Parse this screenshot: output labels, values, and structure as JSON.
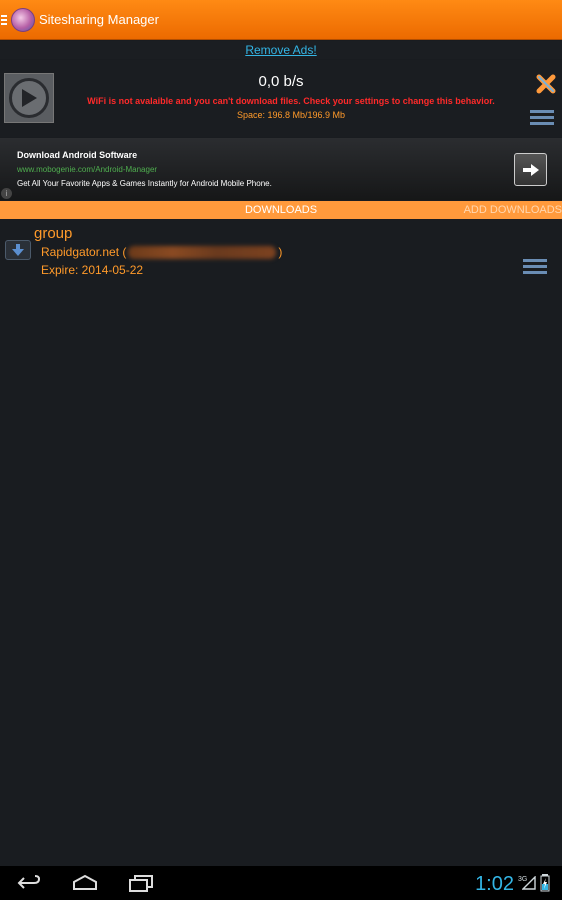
{
  "app": {
    "title": "Sitesharing Manager",
    "accent_color": "#ff8a14",
    "link_color": "#33b5e5"
  },
  "remove_ads": {
    "label": "Remove Ads!"
  },
  "status": {
    "speed": "0,0 b/s",
    "warning": "WiFi is not avalaible and you can't download files. Check your settings to change this behavior.",
    "space": "Space: 196.8 Mb/196.9 Mb",
    "icons": [
      "play-icon",
      "close-icon",
      "menu-icon"
    ]
  },
  "ad": {
    "title": "Download Android Software",
    "url": "www.mobogenie.com/Android-Manager",
    "description": "Get All Your Favorite Apps & Games Instantly for Android Mobile Phone.",
    "info_glyph": "i"
  },
  "tabs": {
    "active": "DOWNLOADS",
    "other": "ADD DOWNLOADS"
  },
  "downloads": [
    {
      "group": "group",
      "host_prefix": "Rapidgator.net (",
      "host_suffix": ")",
      "expire": "Expire: 2014-05-22"
    }
  ],
  "navbar": {
    "time": "1:02",
    "network": "3G",
    "buttons": [
      "back-icon",
      "home-icon",
      "recent-apps-icon"
    ]
  }
}
